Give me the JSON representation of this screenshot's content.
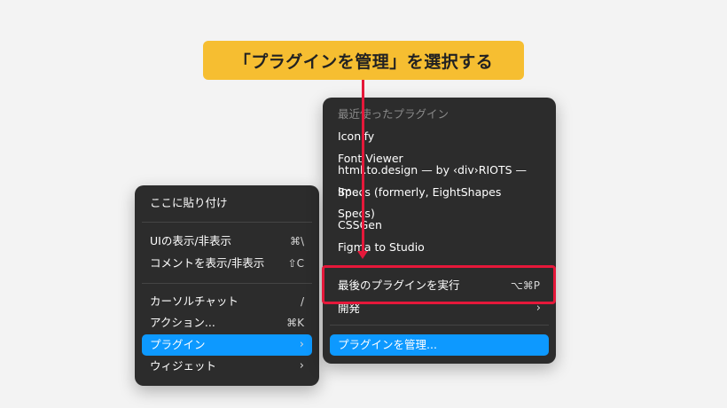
{
  "callout": {
    "text": "「プラグインを管理」を選択する"
  },
  "left_menu": {
    "items": [
      {
        "label": "ここに貼り付け",
        "shortcut": ""
      },
      {
        "label": "UIの表示/非表示",
        "shortcut": "⌘\\"
      },
      {
        "label": "コメントを表示/非表示",
        "shortcut": "⇧C"
      },
      {
        "label": "カーソルチャット",
        "shortcut": "/"
      },
      {
        "label": "アクション...",
        "shortcut": "⌘K"
      },
      {
        "label": "プラグイン",
        "shortcut": "›"
      },
      {
        "label": "ウィジェット",
        "shortcut": "›"
      }
    ]
  },
  "right_menu": {
    "header": "最近使ったプラグイン",
    "recent_plugins": [
      "Iconify",
      "Font Viewer",
      "html.to.design — by ‹div›RIOTS — Im...",
      "Specs (formerly, EightShapes Specs)",
      "CSSGen",
      "Figma to Studio"
    ],
    "run_last": {
      "label": "最後のプラグインを実行",
      "shortcut": "⌥⌘P"
    },
    "development": {
      "label": "開発",
      "shortcut": "›"
    },
    "manage": {
      "label": "プラグインを管理..."
    }
  },
  "colors": {
    "callout_bg": "#f6be31",
    "highlight": "#0d99ff",
    "annotation_red": "#e5183a",
    "menu_bg": "#2c2c2c"
  }
}
